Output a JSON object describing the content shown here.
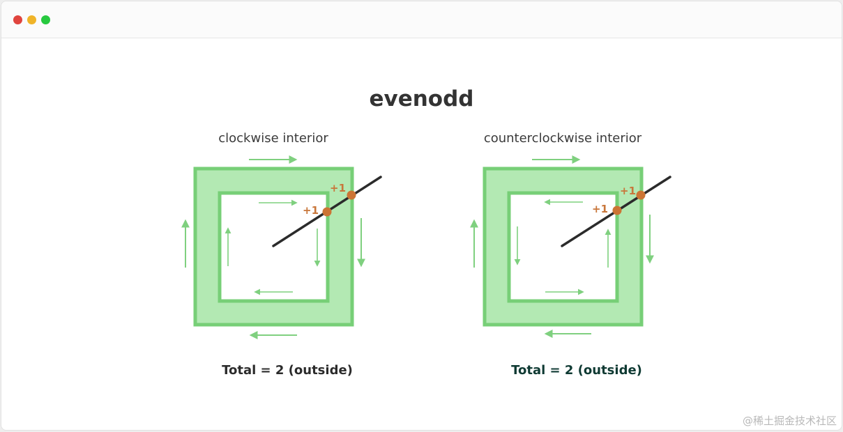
{
  "window": {
    "controls": [
      "close",
      "minimize",
      "maximize"
    ]
  },
  "title": "evenodd",
  "panels": [
    {
      "label": "clockwise interior",
      "total": "Total = 2 (outside)",
      "crossings": [
        "+1",
        "+1"
      ]
    },
    {
      "label": "counterclockwise interior",
      "total": "Total = 2 (outside)",
      "crossings": [
        "+1",
        "+1"
      ]
    }
  ],
  "watermark": "@稀土掘金技术社区",
  "colors": {
    "fill": "#b3e9b3",
    "stroke": "#77cf77",
    "arrow": "#7fd07f",
    "point": "#cc7434",
    "ray": "#2b2b2b",
    "label": "#c8763a"
  }
}
